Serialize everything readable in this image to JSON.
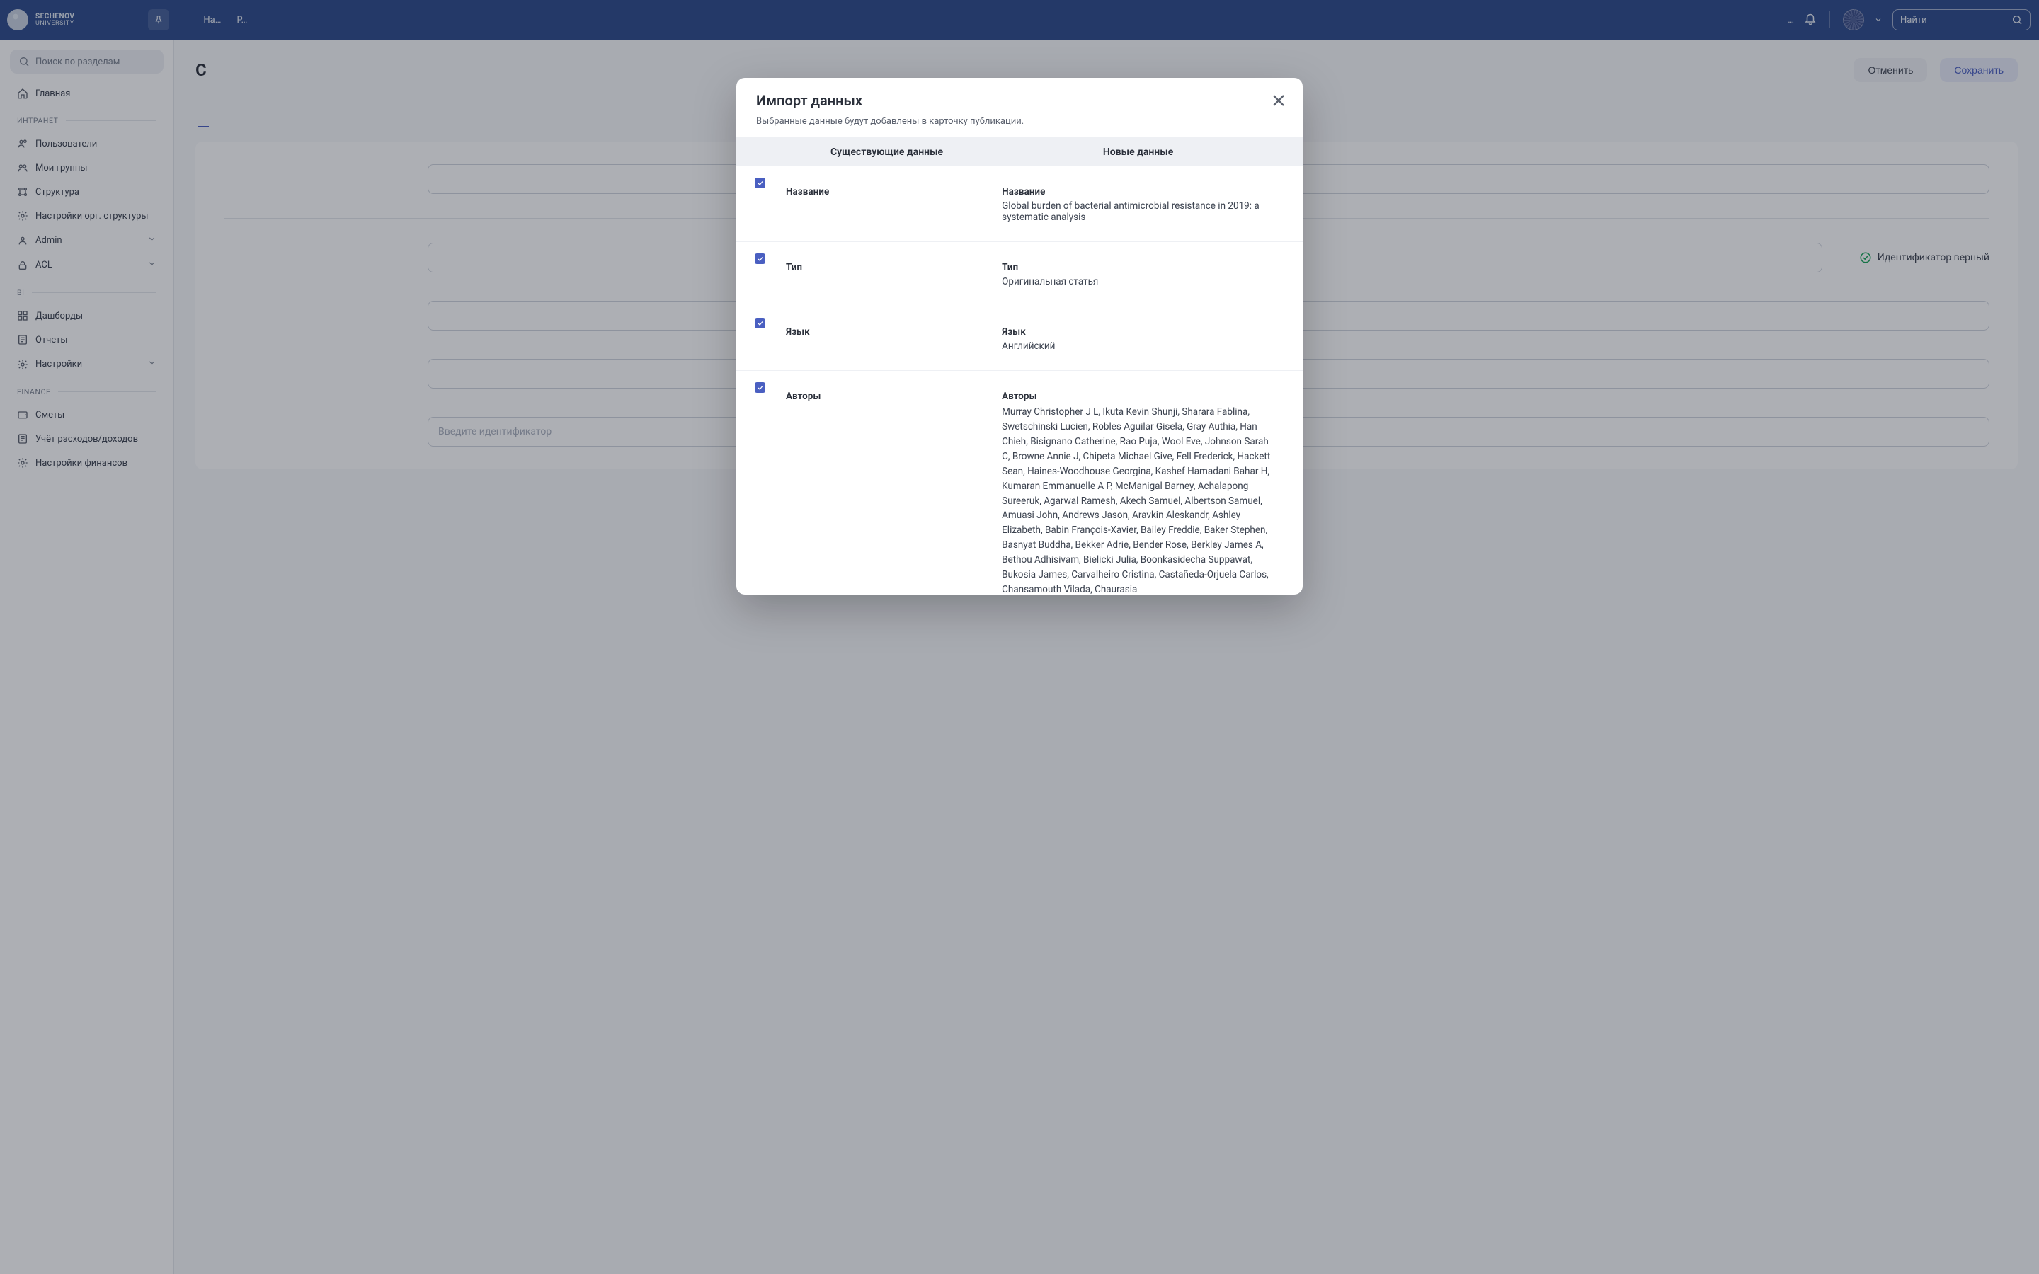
{
  "header": {
    "logo_line1": "SECHENOV",
    "logo_line2": "UNIVERSITY",
    "nav": [
      "На…",
      "Р…",
      "…",
      "…",
      "…",
      "…"
    ],
    "right_text": "…",
    "search_placeholder": "Найти"
  },
  "sidebar": {
    "search_placeholder": "Поиск по разделам",
    "home": "Главная",
    "sections": {
      "intranet": {
        "label": "ИНТРАНЕТ",
        "items": [
          "Пользователи",
          "Мои группы",
          "Структура",
          "Настройки орг. структуры",
          "Admin",
          "ACL"
        ]
      },
      "bi": {
        "label": "BI",
        "items": [
          "Дашборды",
          "Отчеты",
          "Настройки"
        ]
      },
      "finance": {
        "label": "FINANCE",
        "items": [
          "Сметы",
          "Учёт расходов/доходов",
          "Настройки финансов"
        ]
      }
    }
  },
  "page": {
    "title_prefix": "С",
    "cancel": "Отменить",
    "save": "Сохранить",
    "verify_label": "Идентификатор верный",
    "input_placeholder": "Введите идентификатор"
  },
  "modal": {
    "title": "Импорт данных",
    "subtitle": "Выбранные данные будут добавлены в карточку публикации.",
    "col_left": "Существующие данные",
    "col_right": "Новые данные",
    "rows": [
      {
        "label_l": "Название",
        "label_r": "Название",
        "value_r": "Global burden of bacterial antimicrobial resistance in 2019: a systematic analysis"
      },
      {
        "label_l": "Тип",
        "label_r": "Тип",
        "value_r": "Оригинальная статья"
      },
      {
        "label_l": "Язык",
        "label_r": "Язык",
        "value_r": "Английский"
      },
      {
        "label_l": "Авторы",
        "label_r": "Авторы",
        "value_r": "Murray Christopher J L, Ikuta Kevin Shunji, Sharara Fablina, Swetschinski Lucien, Robles Aguilar Gisela, Gray Authia, Han Chieh, Bisignano Catherine, Rao Puja, Wool Eve, Johnson Sarah C, Browne Annie J, Chipeta Michael Give, Fell Frederick, Hackett Sean, Haines-Woodhouse Georgina, Kashef Hamadani Bahar H, Kumaran Emmanuelle A P, McManigal Barney, Achalapong Sureeruk, Agarwal Ramesh, Akech Samuel, Albertson Samuel, Amuasi John, Andrews Jason, Aravkin Aleskandr, Ashley Elizabeth, Babin François-Xavier, Bailey Freddie, Baker Stephen, Basnyat Buddha, Bekker Adrie, Bender Rose, Berkley James A, Bethou Adhisivam, Bielicki Julia, Boonkasidecha Suppawat, Bukosia James, Carvalheiro Cristina, Castañeda-Orjuela Carlos, Chansamouth Vilada, Chaurasia"
      }
    ]
  }
}
